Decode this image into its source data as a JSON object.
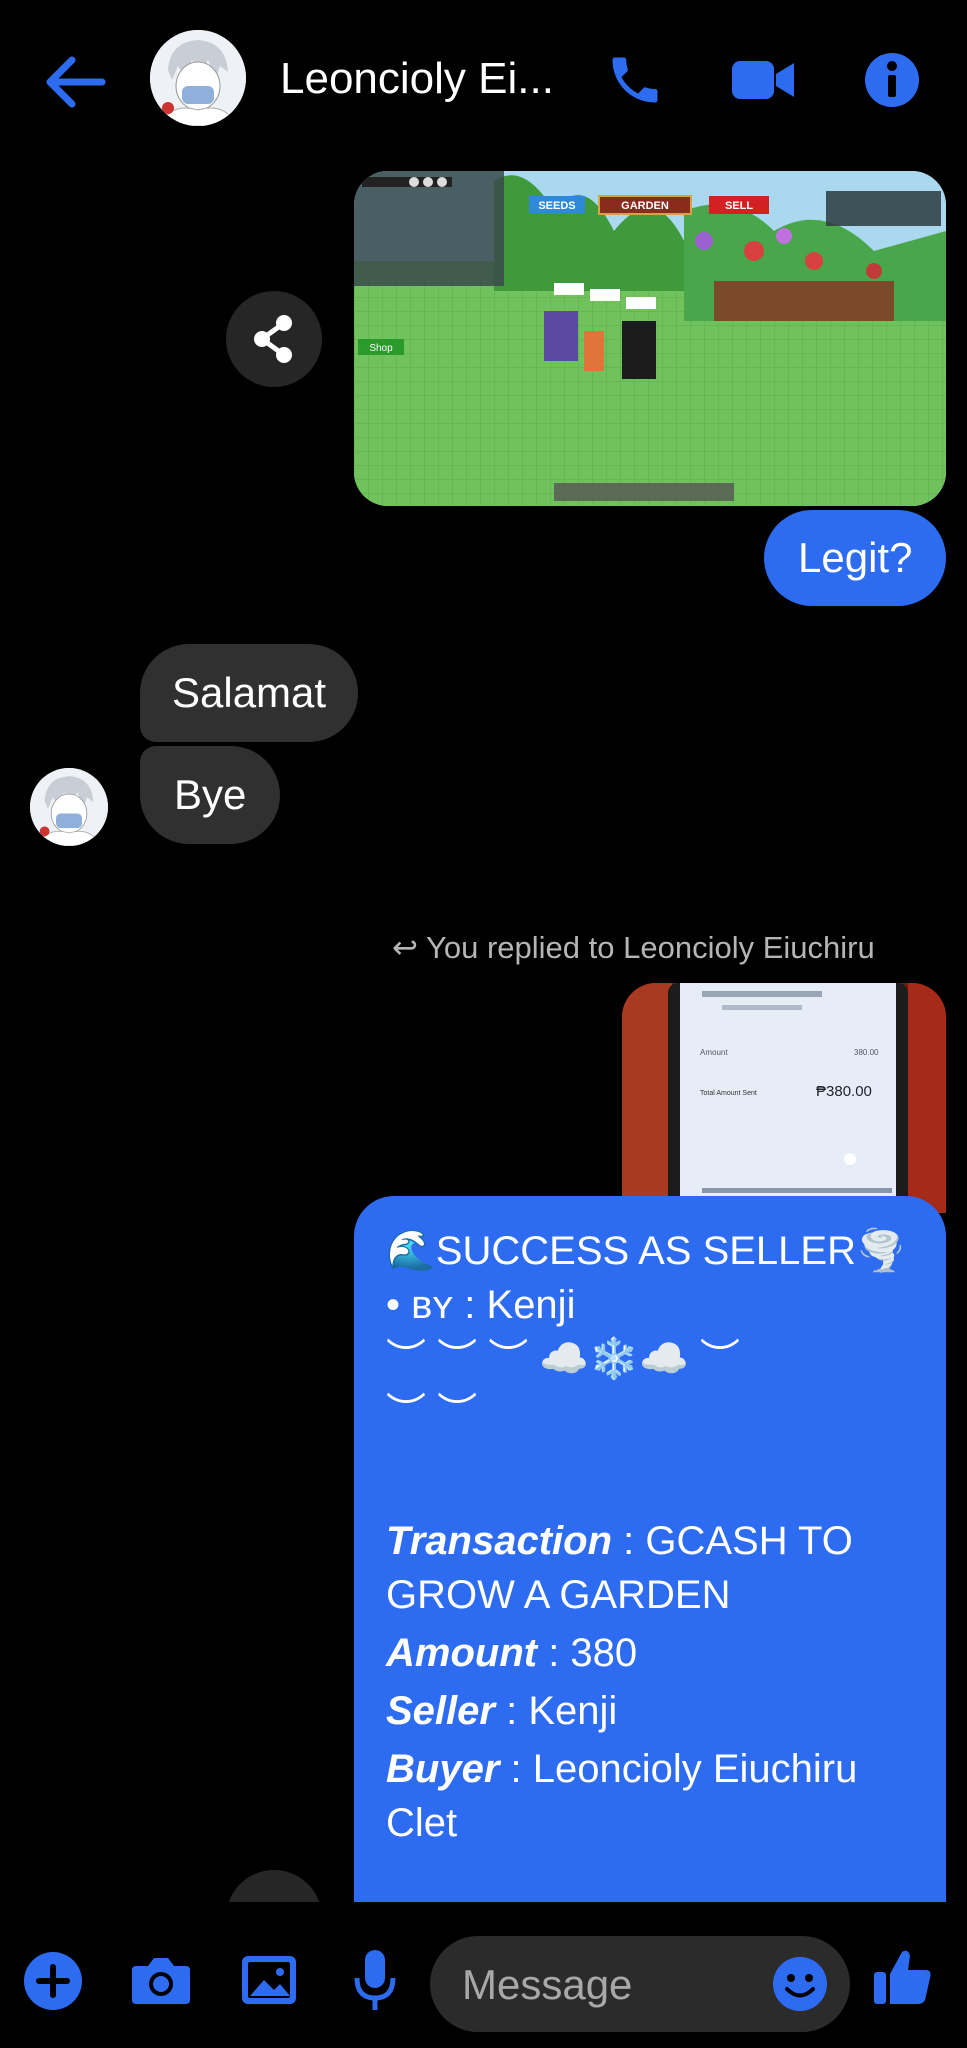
{
  "header": {
    "contact_name": "Leoncioly Ei...",
    "icons": [
      "back-arrow-icon",
      "phone-icon",
      "video-camera-icon",
      "info-icon"
    ],
    "accent": "#2d6bf1"
  },
  "game_screenshot": {
    "buttons": [
      "SEEDS",
      "GARDEN",
      "SELL"
    ],
    "shop_label": "Shop"
  },
  "messages": {
    "legit": "Legit?",
    "salamat": "Salamat",
    "bye": "Bye",
    "replied_note": "You replied to Leoncioly Eiuchiru",
    "receipt_amount": "₱380.00",
    "receipt_total_label": "Total Amount Sent",
    "receipt_amount_label": "Amount",
    "receipt_amount_value": "380.00",
    "big": {
      "line1": "🌊SUCCESS AS SELLER🌪️",
      "by_label": "• ʙʏ",
      "by_value": ": Kenji",
      "deco1": "︶ ︶ ︶ ☁️❄️☁️ ︶",
      "deco2": "︶ ︶",
      "transaction_label": "Transaction",
      "transaction_value": ": GCASH TO",
      "transaction_value2": "GROW A GARDEN",
      "amount_label": "Amount",
      "amount_value": ": 380",
      "seller_label": "Seller",
      "seller_value": ": Kenji",
      "buyer_label": "Buyer",
      "buyer_value": ": Leoncioly Eiuchiru",
      "buyer_value2": "Clet"
    }
  },
  "composer": {
    "placeholder": "Message",
    "icons": [
      "plus-icon",
      "camera-icon",
      "gallery-icon",
      "microphone-icon",
      "emoji-icon",
      "thumbs-up-icon"
    ]
  }
}
